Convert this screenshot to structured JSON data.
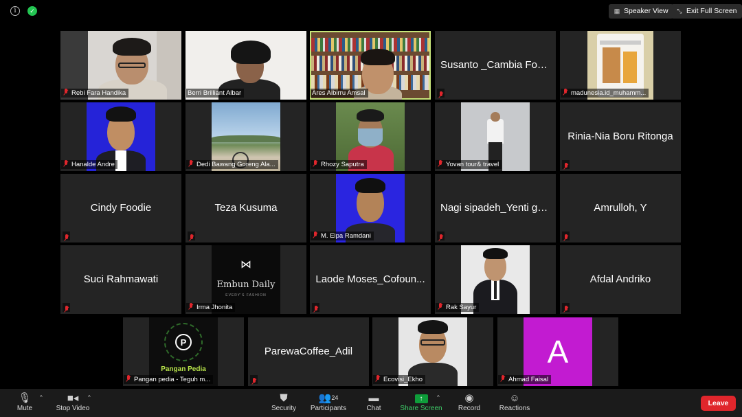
{
  "top_bar": {
    "speaker_view_label": "Speaker View",
    "exit_fullscreen_label": "Exit Full Screen"
  },
  "participants": [
    {
      "name": "Rebi Fara Handika",
      "video": true
    },
    {
      "name": "Berri Brilliant Albar",
      "video": true
    },
    {
      "name": "Ares Albirru Amsal",
      "video": true,
      "active_speaker": true
    },
    {
      "name": "Susanto _Cambia Foo...",
      "video": false
    },
    {
      "name": "madunesia.id_muhamm...",
      "video": true
    },
    {
      "name": "Hanalde Andre",
      "video": true
    },
    {
      "name": "Dedi Bawang Goreng Ala...",
      "video": true
    },
    {
      "name": "Rhozy Saputra",
      "video": true
    },
    {
      "name": "Yovan tour& travel",
      "video": true
    },
    {
      "name": "Rinia-Nia Boru Ritonga",
      "video": false
    },
    {
      "name": "Cindy Foodie",
      "video": false
    },
    {
      "name": "Teza Kusuma",
      "video": false
    },
    {
      "name": "M. Elpa Ramdani",
      "video": true
    },
    {
      "name": "Nagi sipadeh_Yenti gu...",
      "video": false
    },
    {
      "name": "Amrulloh, Y",
      "video": false
    },
    {
      "name": "Suci Rahmawati",
      "video": false
    },
    {
      "name": "Irma Jhonita",
      "video": true,
      "logo_text": "Embun Daily",
      "logo_subtext": "EVERY'S FASHION"
    },
    {
      "name": "Laode Moses_Cofoun...",
      "video": false
    },
    {
      "name": "Rak Sayur",
      "video": true
    },
    {
      "name": "Afdal Andriko",
      "video": false
    },
    {
      "name": "Pangan pedia - Teguh m...",
      "video": true,
      "logo_text": "Pangan Pedia"
    },
    {
      "name": "ParewaCoffee_Adil",
      "video": false
    },
    {
      "name": "Ecovisi_Ekho",
      "video": true
    },
    {
      "name": "Ahmad Faisal",
      "video": true,
      "avatar_letter": "A",
      "avatar_color": "#c21bd1"
    }
  ],
  "toolbar": {
    "mute_label": "Mute",
    "stop_video_label": "Stop Video",
    "security_label": "Security",
    "participants_label": "Participants",
    "participants_count": "24",
    "chat_label": "Chat",
    "share_screen_label": "Share Screen",
    "record_label": "Record",
    "reactions_label": "Reactions",
    "leave_label": "Leave"
  },
  "colors": {
    "accent_green": "#23c552",
    "leave_red": "#e0262c",
    "active_speaker_border": "#c7e57a",
    "tile_bg": "#242424"
  }
}
